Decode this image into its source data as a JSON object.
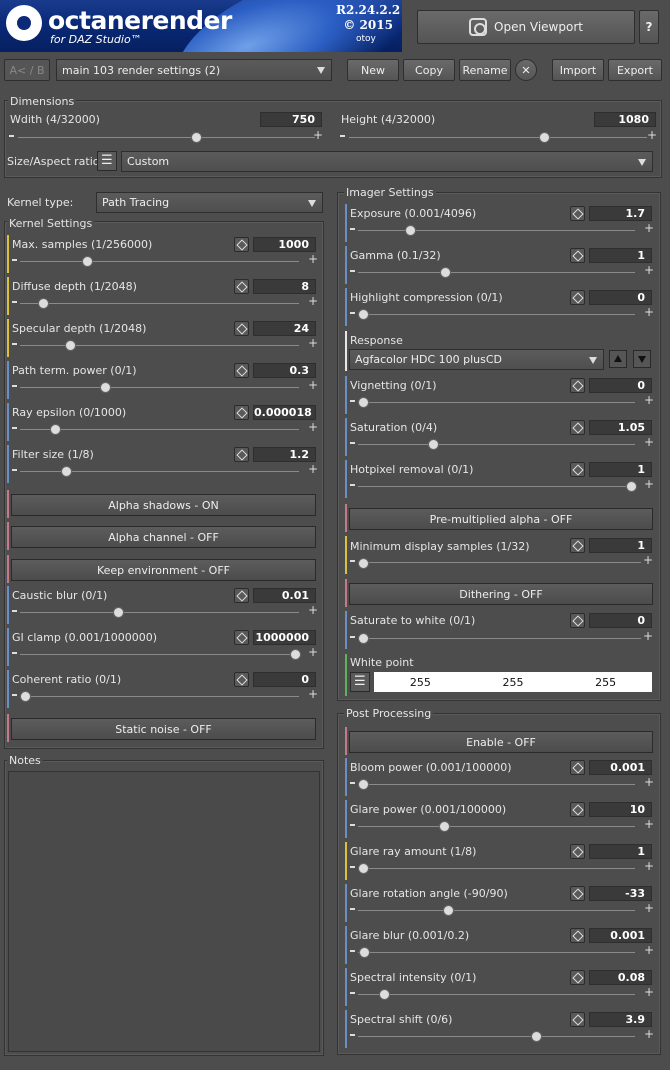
{
  "header": {
    "logo_text": "octanerender",
    "logo_sub": "for DAZ Studio™",
    "version_line1": "R2.24.2.2",
    "version_line2": "© 2015",
    "brand": "otoy",
    "open_viewport": "Open Viewport",
    "help": "?"
  },
  "toolbar": {
    "ab": "A< / B",
    "preset": "main 103 render settings (2)",
    "new": "New",
    "copy": "Copy",
    "rename": "Rename",
    "delete": "✕",
    "import": "Import",
    "export": "Export"
  },
  "dimensions": {
    "title": "Dimensions",
    "width_label": "Wdith (4/32000)",
    "width_value": "750",
    "width_pos": 0.02,
    "height_label": "Height (4/32000)",
    "height_value": "1080",
    "height_pos": 0.03,
    "aspect_label": "Size/Aspect ratio:",
    "aspect_value": "Custom"
  },
  "kernel": {
    "type_label": "Kernel type:",
    "type_value": "Path Tracing",
    "settings_title": "Kernel Settings",
    "params": [
      {
        "label": "Max. samples (1/256000)",
        "value": "1000",
        "color": "#d6c23c",
        "pos": 0.004
      },
      {
        "label": "Diffuse depth (1/2048)",
        "value": "8",
        "color": "#d6c23c",
        "pos": 0.004
      },
      {
        "label": "Specular depth (1/2048)",
        "value": "24",
        "color": "#d6c23c",
        "pos": 0.011
      },
      {
        "label": "Path term. power (0/1)",
        "value": "0.3",
        "color": "#6b8fc4",
        "pos": 0.3
      },
      {
        "label": "Ray epsilon (0/1000)",
        "value": "0.000018",
        "color": "#6b8fc4",
        "pos": 0.0
      },
      {
        "label": "Filter size (1/8)",
        "value": "1.2",
        "color": "#6b8fc4",
        "pos": 0.03
      }
    ],
    "alpha_shadows": "Alpha shadows - ON",
    "alpha_channel": "Alpha channel - OFF",
    "keep_environment": "Keep environment - OFF",
    "params2": [
      {
        "label": "Caustic blur (0/1)",
        "value": "0.01",
        "color": "#6b8fc4",
        "pos": 0.01
      },
      {
        "label": "GI clamp (0.001/1000000)",
        "value": "1000000",
        "color": "#6b8fc4",
        "pos": 1.0
      },
      {
        "label": "Coherent ratio (0/1)",
        "value": "0",
        "color": "#6b8fc4",
        "pos": 0.0
      }
    ],
    "static_noise": "Static noise - OFF"
  },
  "notes": {
    "title": "Notes"
  },
  "imager": {
    "title": "Imager Settings",
    "params": [
      {
        "label": "Exposure (0.001/4096)",
        "value": "1.7",
        "color": "#6b8fc4",
        "pos": 0.0004
      },
      {
        "label": "Gamma (0.1/32)",
        "value": "1",
        "color": "#6b8fc4",
        "pos": 0.028
      },
      {
        "label": "Highlight compression (0/1)",
        "value": "0",
        "color": "#6b8fc4",
        "pos": 0.0
      }
    ],
    "response_label": "Response",
    "response_value": "Agfacolor HDC 100 plusCD",
    "params2": [
      {
        "label": "Vignetting (0/1)",
        "value": "0",
        "color": "#6b8fc4",
        "pos": 0.0
      },
      {
        "label": "Saturation (0/4)",
        "value": "1.05",
        "color": "#6b8fc4",
        "pos": 0.26
      },
      {
        "label": "Hotpixel removal (0/1)",
        "value": "1",
        "color": "#6b8fc4",
        "pos": 1.0
      }
    ],
    "premultiplied": "Pre-multiplied alpha - OFF",
    "min_display_label": "Minimum display samples (1/32)",
    "min_display_value": "1",
    "dithering": "Dithering - OFF",
    "saturate_label": "Saturate to white (0/1)",
    "saturate_value": "0",
    "white_point_label": "White point",
    "white_point": [
      "255",
      "255",
      "255"
    ]
  },
  "post": {
    "title": "Post Processing",
    "enable": "Enable - OFF",
    "params": [
      {
        "label": "Bloom power (0.001/100000)",
        "value": "0.001",
        "color": "#6b8fc4",
        "pos": 0.0
      },
      {
        "label": "Glare power (0.001/100000)",
        "value": "10",
        "color": "#6b8fc4",
        "pos": 0.0001
      },
      {
        "label": "Glare ray amount (1/8)",
        "value": "1",
        "color": "#d6c23c",
        "pos": 0.0
      },
      {
        "label": "Glare rotation angle (-90/90)",
        "value": "-33",
        "color": "#6b8fc4",
        "pos": 0.32
      },
      {
        "label": "Glare blur (0.001/0.2)",
        "value": "0.001",
        "color": "#6b8fc4",
        "pos": 0.0
      },
      {
        "label": "Spectral intensity (0/1)",
        "value": "0.08",
        "color": "#6b8fc4",
        "pos": 0.08
      },
      {
        "label": "Spectral shift (0/6)",
        "value": "3.9",
        "color": "#6b8fc4",
        "pos": 0.65
      }
    ]
  }
}
